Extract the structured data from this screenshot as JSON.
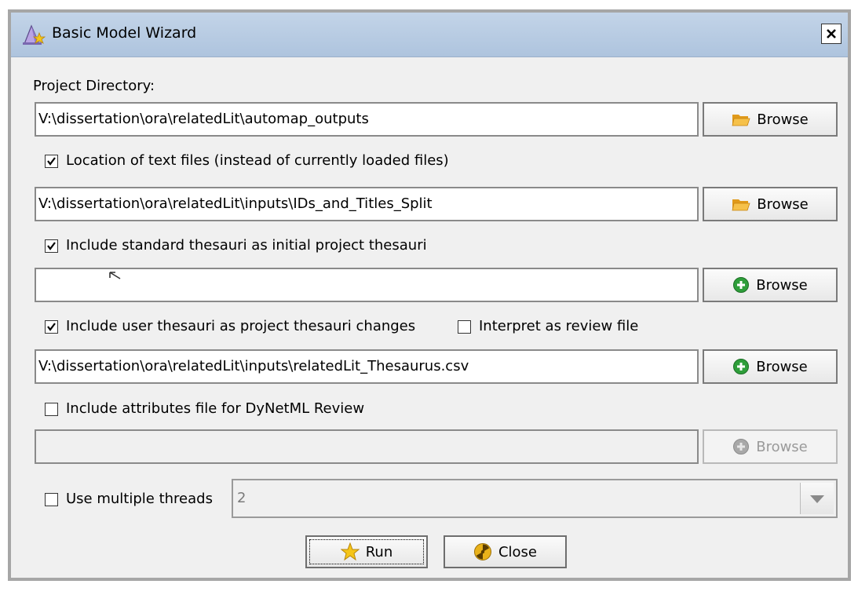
{
  "window": {
    "title": "Basic Model Wizard",
    "close_label": "X"
  },
  "project_dir": {
    "label": "Project Directory:",
    "value": "V:\\dissertation\\ora\\relatedLit\\automap_outputs",
    "browse_label": "Browse"
  },
  "text_files": {
    "checkbox_label": "Location of text files (instead of currently loaded files)",
    "checked": true,
    "value": "V:\\dissertation\\ora\\relatedLit\\inputs\\IDs_and_Titles_Split",
    "browse_label": "Browse"
  },
  "standard_thesauri": {
    "checkbox_label": "Include standard thesauri as initial project thesauri",
    "checked": true,
    "value": "",
    "browse_label": "Browse"
  },
  "user_thesauri": {
    "checkbox_label": "Include user thesauri as project thesauri changes",
    "checked": true,
    "review_label": "Interpret as review file",
    "review_checked": false,
    "value": "V:\\dissertation\\ora\\relatedLit\\inputs\\relatedLit_Thesaurus.csv",
    "browse_label": "Browse"
  },
  "attributes_file": {
    "checkbox_label": "Include attributes file for DyNetML Review",
    "checked": false,
    "value": "",
    "browse_label": "Browse"
  },
  "threads": {
    "checkbox_label": "Use multiple threads",
    "checked": false,
    "value": "2"
  },
  "actions": {
    "run_label": "Run",
    "close_label": "Close"
  },
  "icons": {
    "title": "wizard-hat-icon",
    "folder": "folder-icon",
    "add": "green-plus-icon",
    "run": "star-icon",
    "close": "stop-icon"
  },
  "colors": {
    "titlebar": "#b8cce4",
    "folder": "#f2b431",
    "add_green": "#2e9e3a",
    "star": "#f5c518"
  }
}
